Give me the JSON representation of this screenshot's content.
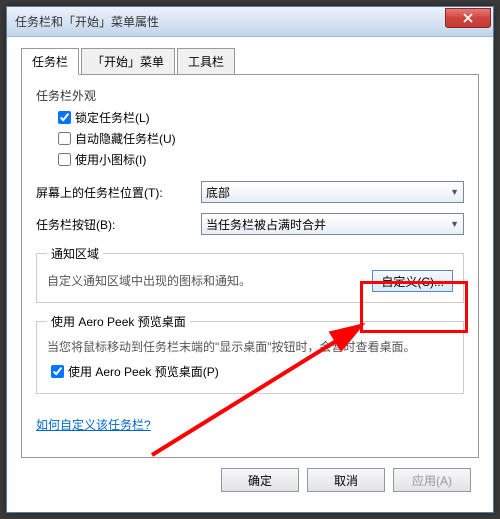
{
  "window": {
    "title": "任务栏和「开始」菜单属性"
  },
  "tabs": {
    "taskbar": "任务栏",
    "start": "「开始」菜单",
    "toolbars": "工具栏"
  },
  "appearance": {
    "heading": "任务栏外观",
    "lock": "锁定任务栏(L)",
    "autohide": "自动隐藏任务栏(U)",
    "smallicons": "使用小图标(I)"
  },
  "position": {
    "label": "屏幕上的任务栏位置(T):",
    "value": "底部"
  },
  "buttons": {
    "label": "任务栏按钮(B):",
    "value": "当任务栏被占满时合并"
  },
  "notify": {
    "legend": "通知区域",
    "desc": "自定义通知区域中出现的图标和通知。",
    "btn": "自定义(C)..."
  },
  "aero": {
    "legend": "使用 Aero Peek 预览桌面",
    "desc": "当您将鼠标移动到任务栏末端的\"显示桌面\"按钮时，会暂时查看桌面。",
    "check": "使用 Aero Peek 预览桌面(P)"
  },
  "link": "如何自定义该任务栏?",
  "dlg": {
    "ok": "确定",
    "cancel": "取消",
    "apply": "应用(A)"
  }
}
